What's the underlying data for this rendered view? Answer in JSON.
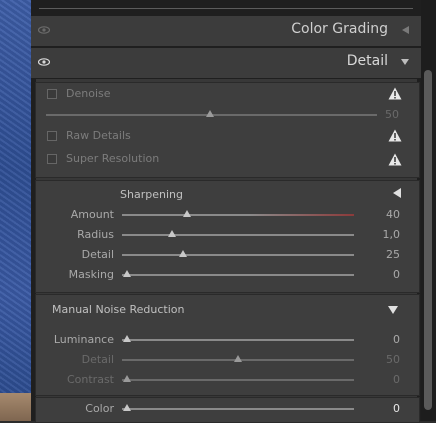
{
  "panel": {
    "color_grading": {
      "title": "Color Grading",
      "icon": "eye-icon",
      "arrow": "collapse-left-icon"
    },
    "detail": {
      "title": "Detail",
      "icon": "eye-icon",
      "arrow": "expand-down-icon"
    }
  },
  "enhance": {
    "denoise": {
      "label": "Denoise",
      "checked": false,
      "value": "50",
      "warning_icon": "warning-icon"
    },
    "raw_details": {
      "label": "Raw Details",
      "checked": false,
      "warning_icon": "warning-icon"
    },
    "super_resolution": {
      "label": "Super Resolution",
      "checked": false,
      "warning_icon": "warning-icon"
    }
  },
  "sharpening": {
    "title": "Sharpening",
    "amount": {
      "label": "Amount",
      "value": "40",
      "level": 0.27
    },
    "radius": {
      "label": "Radius",
      "value": "1,0",
      "level": 0.2
    },
    "detail": {
      "label": "Detail",
      "value": "25",
      "level": 0.25
    },
    "masking": {
      "label": "Masking",
      "value": "0",
      "level": 0.0
    }
  },
  "manual_noise_reduction": {
    "title": "Manual Noise Reduction",
    "luminance": {
      "label": "Luminance",
      "value": "0",
      "level": 0.0
    },
    "detail": {
      "label": "Detail",
      "value": "50",
      "level": 0.5
    },
    "contrast": {
      "label": "Contrast",
      "value": "0",
      "level": 0.0
    },
    "color": {
      "label": "Color",
      "value": "0",
      "level": 0.0
    }
  },
  "colors": {
    "amount_track_accent": "#8b3a3a"
  }
}
